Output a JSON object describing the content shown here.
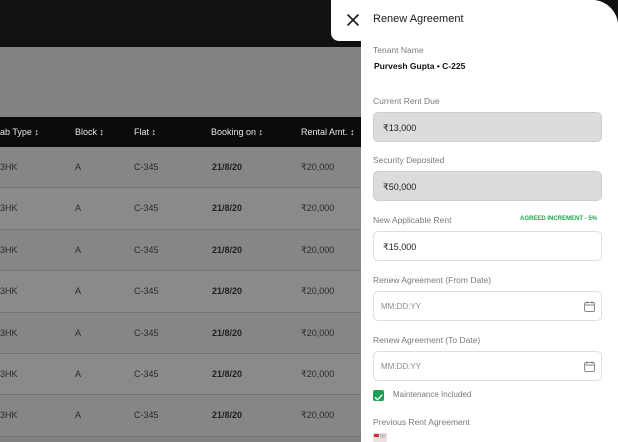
{
  "table": {
    "headers": [
      "ab Type ↕",
      "Block ↕",
      "Flat ↕",
      "Booking on ↕",
      "Rental Amt. ↕"
    ],
    "rows": [
      [
        "3HK",
        "A",
        "C-345",
        "21/8/20",
        "₹20,000"
      ],
      [
        "3HK",
        "A",
        "C-345",
        "21/8/20",
        "₹20,000"
      ],
      [
        "3HK",
        "A",
        "C-345",
        "21/8/20",
        "₹20,000"
      ],
      [
        "3HK",
        "A",
        "C-345",
        "21/8/20",
        "₹20,000"
      ],
      [
        "3HK",
        "A",
        "C-345",
        "21/8/20",
        "₹20,000"
      ],
      [
        "3HK",
        "A",
        "C-345",
        "21/8/20",
        "₹20,000"
      ],
      [
        "3HK",
        "A",
        "C-345",
        "21/8/20",
        "₹20,000"
      ]
    ]
  },
  "panel": {
    "title": "Renew Agreement",
    "tenant_label": "Tenant Name",
    "tenant_value": "Purvesh Gupta •  C-225",
    "rent_due_label": "Current Rent Due",
    "rent_due_value": "₹13,000",
    "security_label": "Security Deposited",
    "security_value": "₹50,000",
    "new_rent_label": "New Applicable Rent",
    "increment_badge": "AGREED INCREMENT - 5%",
    "new_rent_value": "₹15,000",
    "from_label": "Renew Agreement (From Date)",
    "from_placeholder": "MM:DD:YY",
    "to_label": "Renew Agreement (To Date)",
    "to_placeholder": "MM:DD:YY",
    "maintenance_label": "Maintenance Included",
    "maintenance_checked": true,
    "previous_label": "Previous Rent Agreement"
  },
  "icons": {
    "close": "close-icon",
    "calendar": "calendar-icon",
    "check": "check-icon",
    "pdf": "pdf-file-icon"
  },
  "colors": {
    "accent_green": "#1f9d55"
  }
}
